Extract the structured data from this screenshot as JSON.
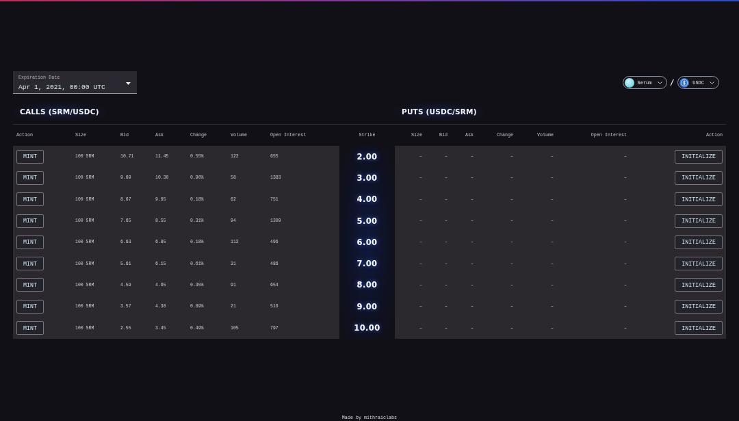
{
  "expiration": {
    "label": "Expiration Date",
    "value": "Apr 1, 2021, 00:00 UTC"
  },
  "pair": {
    "base": "Serum",
    "separator": "/",
    "quote": "USDC"
  },
  "calls": {
    "title": "CALLS (SRM/USDC)",
    "columns": [
      {
        "label": "Action",
        "kind": "button"
      },
      {
        "label": "Size",
        "kind": "text"
      },
      {
        "label": "Bid",
        "kind": "text"
      },
      {
        "label": "Ask",
        "kind": "text"
      },
      {
        "label": "Change",
        "kind": "text"
      },
      {
        "label": "Volume",
        "kind": "text"
      },
      {
        "label": "Open Interest",
        "kind": "text"
      }
    ],
    "rows": [
      {
        "cells": [
          "MINT",
          "100 SRM",
          "10.71",
          "11.45",
          "0.55%",
          "122",
          "655"
        ]
      },
      {
        "cells": [
          "MINT",
          "100 SRM",
          "9.69",
          "10.30",
          "0.90%",
          "58",
          "1383"
        ]
      },
      {
        "cells": [
          "MINT",
          "100 SRM",
          "8.67",
          "9.65",
          "0.18%",
          "62",
          "751"
        ]
      },
      {
        "cells": [
          "MINT",
          "100 SRM",
          "7.65",
          "8.55",
          "0.31%",
          "94",
          "1309"
        ]
      },
      {
        "cells": [
          "MINT",
          "100 SRM",
          "6.63",
          "6.85",
          "0.18%",
          "112",
          "496"
        ]
      },
      {
        "cells": [
          "MINT",
          "100 SRM",
          "5.61",
          "6.15",
          "0.61%",
          "31",
          "486"
        ]
      },
      {
        "cells": [
          "MINT",
          "100 SRM",
          "4.59",
          "4.65",
          "0.35%",
          "91",
          "654"
        ]
      },
      {
        "cells": [
          "MINT",
          "100 SRM",
          "3.57",
          "4.30",
          "0.89%",
          "21",
          "516"
        ]
      },
      {
        "cells": [
          "MINT",
          "100 SRM",
          "2.55",
          "3.45",
          "0.49%",
          "105",
          "797"
        ]
      }
    ]
  },
  "strike": {
    "header": "Strike",
    "values": [
      "2.00",
      "3.00",
      "4.00",
      "5.00",
      "6.00",
      "7.00",
      "8.00",
      "9.00",
      "10.00"
    ]
  },
  "puts": {
    "title": "PUTS (USDC/SRM)",
    "columns": [
      {
        "label": "Size",
        "kind": "text"
      },
      {
        "label": "Bid",
        "kind": "text"
      },
      {
        "label": "Ask",
        "kind": "text"
      },
      {
        "label": "Change",
        "kind": "text"
      },
      {
        "label": "Volume",
        "kind": "text"
      },
      {
        "label": "Open Interest",
        "kind": "text"
      },
      {
        "label": "Action",
        "kind": "button"
      }
    ],
    "rows": [
      {
        "cells": [
          "–",
          "–",
          "–",
          "–",
          "–",
          "–",
          "INITIALIZE"
        ]
      },
      {
        "cells": [
          "–",
          "–",
          "–",
          "–",
          "–",
          "–",
          "INITIALIZE"
        ]
      },
      {
        "cells": [
          "–",
          "–",
          "–",
          "–",
          "–",
          "–",
          "INITIALIZE"
        ]
      },
      {
        "cells": [
          "–",
          "–",
          "–",
          "–",
          "–",
          "–",
          "INITIALIZE"
        ]
      },
      {
        "cells": [
          "–",
          "–",
          "–",
          "–",
          "–",
          "–",
          "INITIALIZE"
        ]
      },
      {
        "cells": [
          "–",
          "–",
          "–",
          "–",
          "–",
          "–",
          "INITIALIZE"
        ]
      },
      {
        "cells": [
          "–",
          "–",
          "–",
          "–",
          "–",
          "–",
          "INITIALIZE"
        ]
      },
      {
        "cells": [
          "–",
          "–",
          "–",
          "–",
          "–",
          "–",
          "INITIALIZE"
        ]
      },
      {
        "cells": [
          "–",
          "–",
          "–",
          "–",
          "–",
          "–",
          "INITIALIZE"
        ]
      }
    ]
  },
  "footer": "Made by mithraiclabs"
}
